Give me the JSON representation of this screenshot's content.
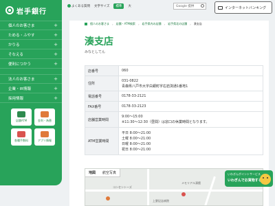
{
  "sidebar": {
    "logo": "岩手銀行",
    "group1": [
      {
        "label": "個人のお客さま"
      },
      {
        "label": "ためる・ふやす"
      },
      {
        "label": "かりる"
      },
      {
        "label": "そなえる"
      },
      {
        "label": "便利につかう"
      }
    ],
    "group2": [
      {
        "label": "法人のお客さま"
      },
      {
        "label": "企業・IR情報"
      },
      {
        "label": "採用情報"
      }
    ],
    "tiles": [
      {
        "label": "店舗ATM",
        "icon": "shop-icon",
        "color": "#2e8a4e"
      },
      {
        "label": "金利・為替",
        "icon": "chart-icon",
        "color": "#e07a3a"
      },
      {
        "label": "各種手数料",
        "icon": "card-icon",
        "color": "#d9534f"
      },
      {
        "label": "アプリ情報",
        "icon": "app-icon",
        "color": "#e07a3a"
      }
    ]
  },
  "header": {
    "faq": "よくある質問",
    "text_size_label": "文字サイズ",
    "size_std": "標準",
    "size_large": "大",
    "search_placeholder": "Google 提供",
    "internet_banking": "インターネットバンキング"
  },
  "breadcrumb": [
    "個人のお客さま",
    "店舗・ATM検索",
    "岩手県内の店舗",
    "岩手県北の店舗",
    "湊支店"
  ],
  "page": {
    "title": "湊支店",
    "kana": "みなとしてん"
  },
  "info": {
    "rows": [
      {
        "label": "店番号",
        "value": "060"
      },
      {
        "label": "住所",
        "value": "031-0822\n青森県八戸市大字白銀町字右岩渕通1番地1"
      },
      {
        "label": "電話番号",
        "value": "0178-33-2121"
      },
      {
        "label": "FAX番号",
        "value": "0178-33-2123"
      },
      {
        "label": "店舗営業時間",
        "value": "9:00～15:00\n※11:30～12:30（昼間）は窓口の休業時間となります。"
      },
      {
        "label": "ATM営業時間",
        "value": "平日 8:00～21:00\n土曜 8:00～21:00\n日曜 8:00～21:00\n祝日 8:00～21:00"
      }
    ]
  },
  "map": {
    "tab_map": "地図",
    "tab_photo": "航空写真",
    "labels": [
      "メモリアル湊館",
      "コンセントーズ",
      "上野記念病院"
    ]
  },
  "banner": {
    "line1": "いわぎんポイントサービス",
    "line2": "いわぎんでお買物する"
  }
}
